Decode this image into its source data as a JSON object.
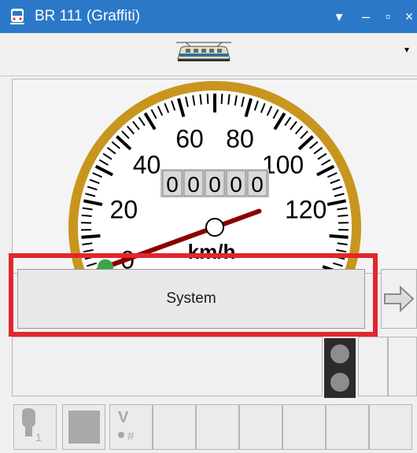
{
  "window": {
    "title": "BR 111 (Graffiti)",
    "icons": [
      "train-app-icon",
      "menu-chevron-icon",
      "minimize-icon",
      "maximize-icon",
      "close-icon"
    ]
  },
  "titlebar": {
    "dropdown_glyph": "▾",
    "minimize_glyph": "–",
    "maximize_glyph": "▫",
    "close_glyph": "×"
  },
  "loco": {
    "dropdown_glyph": "▾"
  },
  "speedometer": {
    "ticks": [
      "0",
      "20",
      "40",
      "60",
      "80",
      "100",
      "120"
    ],
    "unit": "km/h",
    "odometer": [
      "0",
      "0",
      "0",
      "0",
      "0"
    ],
    "needle_speed": 0
  },
  "system_button": {
    "label": "System"
  },
  "colors": {
    "titlebar": "#2b78c9",
    "highlight": "#e2262e",
    "dial_rim": "#c8961e",
    "needle": "#8b0000"
  }
}
